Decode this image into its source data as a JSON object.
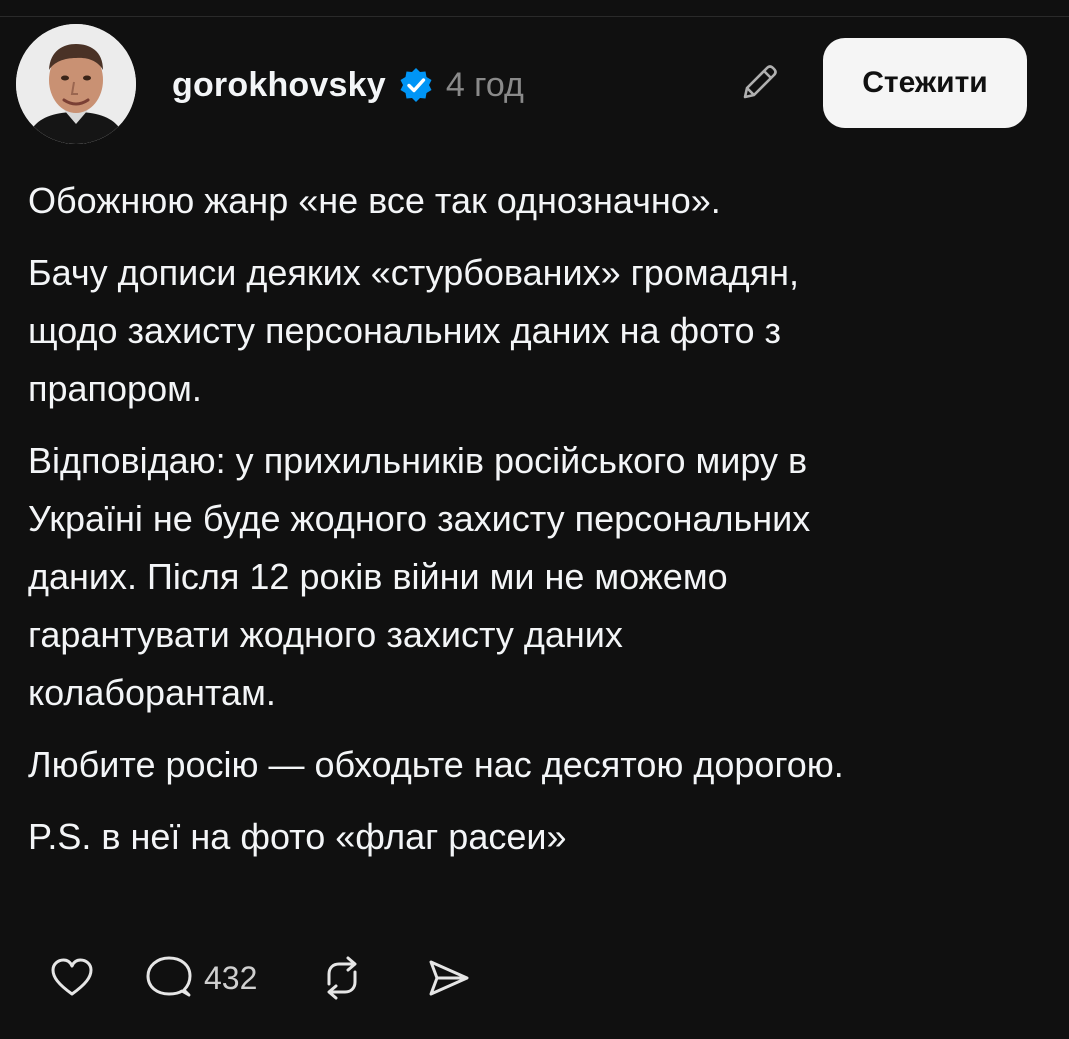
{
  "post": {
    "author": {
      "username": "gorokhovsky",
      "verified": true,
      "avatar": "author-portrait"
    },
    "timestamp": "4 год",
    "follow_label": "Стежити",
    "paragraphs": [
      [
        "Обожнюю жанр «не все так однозначно»."
      ],
      [
        "Бачу дописи деяких «стурбованих» громадян,",
        "щодо захисту персональних даних на фото з",
        "прапором."
      ],
      [
        "Відповідаю: у прихильників російського миру в",
        "Україні не буде жодного захисту персональних",
        "даних. Після 12 років війни ми не можемо",
        "гарантувати жодного захисту даних",
        "колаборантам."
      ],
      [
        "Любите росію — обходьте нас десятою дорогою."
      ],
      [
        "P.S. в неї на фото «флаг расеи»"
      ]
    ],
    "stats": {
      "comments": "432"
    },
    "icons": {
      "verified": "verified-badge-icon",
      "edit": "pencil-icon",
      "like": "heart-icon",
      "comment": "comment-icon",
      "repost": "repost-icon",
      "share": "send-icon"
    },
    "colors": {
      "background": "#101010",
      "text": "#f3f5f7",
      "muted": "#8a8a8a",
      "verified": "#0095f6",
      "button_bg": "#f5f5f5"
    }
  }
}
